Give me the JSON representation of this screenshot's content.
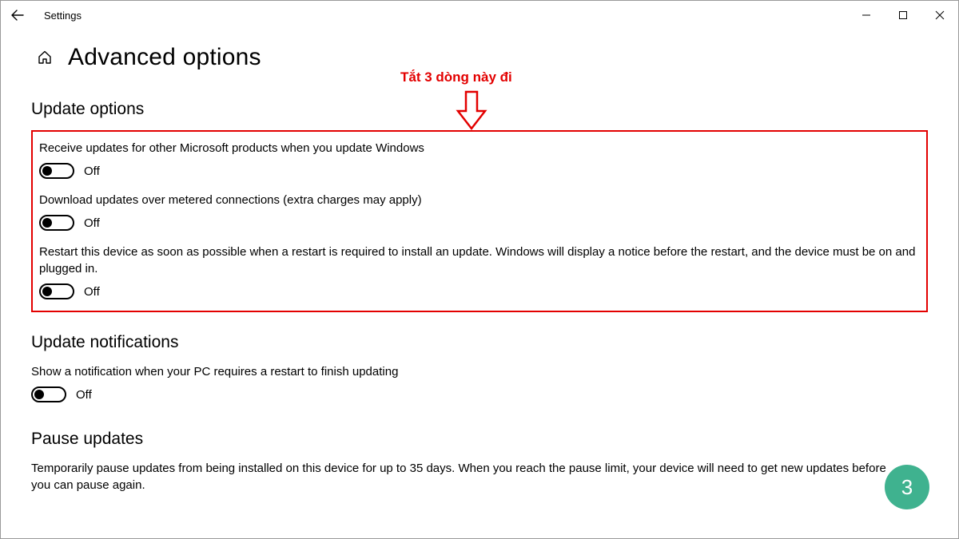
{
  "window": {
    "title": "Settings"
  },
  "page": {
    "heading": "Advanced options"
  },
  "annotation": {
    "text": "Tắt 3 dòng này đi",
    "color": "#e30000"
  },
  "sections": {
    "updateOptions": {
      "heading": "Update options",
      "items": [
        {
          "label": "Receive updates for other Microsoft products when you update Windows",
          "state": "Off"
        },
        {
          "label": "Download updates over metered connections (extra charges may apply)",
          "state": "Off"
        },
        {
          "label": "Restart this device as soon as possible when a restart is required to install an update. Windows will display a notice before the restart, and the device must be on and plugged in.",
          "state": "Off"
        }
      ]
    },
    "updateNotifications": {
      "heading": "Update notifications",
      "items": [
        {
          "label": "Show a notification when your PC requires a restart to finish updating",
          "state": "Off"
        }
      ]
    },
    "pauseUpdates": {
      "heading": "Pause updates",
      "description": "Temporarily pause updates from being installed on this device for up to 35 days. When you reach the pause limit, your device will need to get new updates before you can pause again."
    }
  },
  "stepBadge": {
    "number": "3",
    "color": "#3fb28f"
  }
}
